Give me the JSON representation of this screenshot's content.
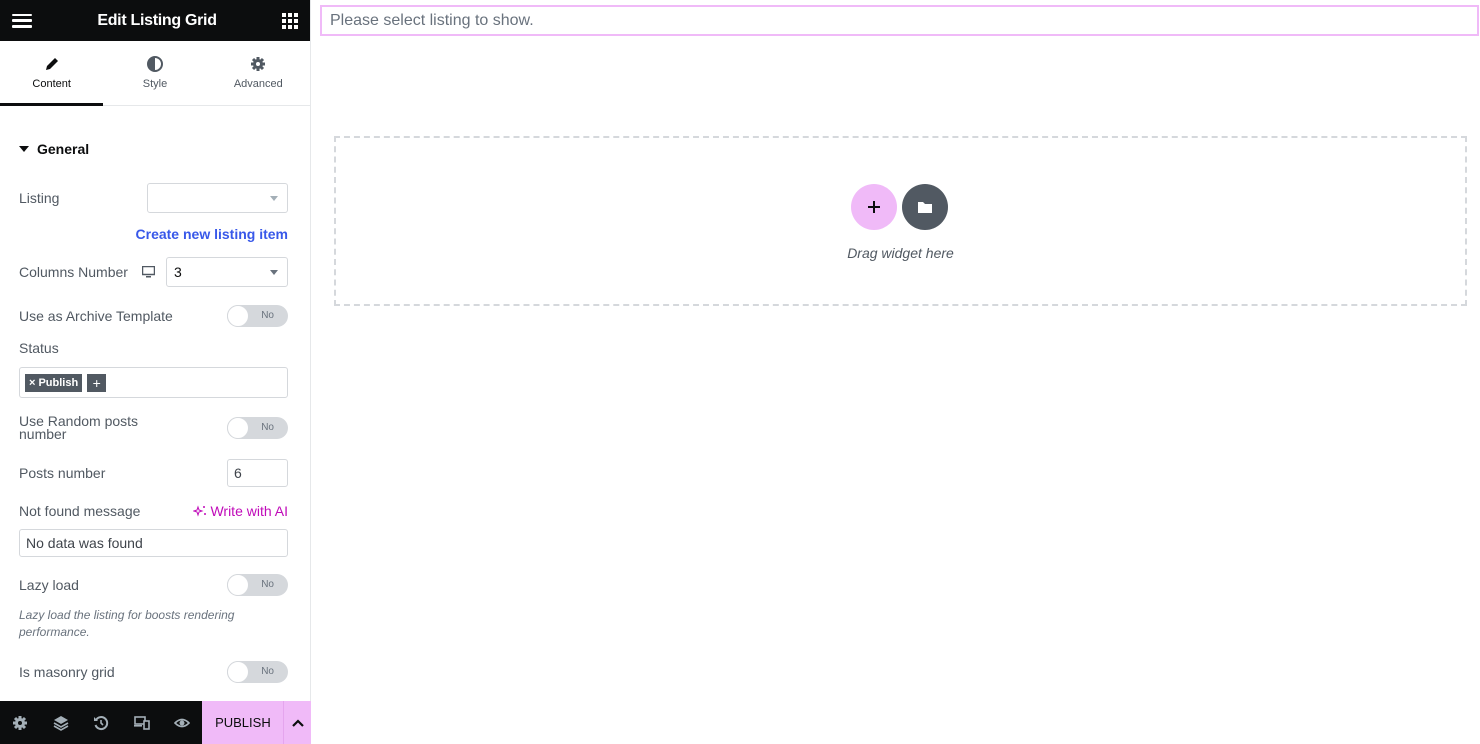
{
  "header": {
    "title": "Edit Listing Grid",
    "menu_icon": "hamburger-icon",
    "apps_icon": "grid-icon"
  },
  "tabs": [
    {
      "label": "Content",
      "icon": "pencil-icon",
      "active": true
    },
    {
      "label": "Style",
      "icon": "half-circle-icon",
      "active": false
    },
    {
      "label": "Advanced",
      "icon": "gear-icon",
      "active": false
    }
  ],
  "section": {
    "title": "General"
  },
  "fields": {
    "listing": {
      "label": "Listing",
      "value": ""
    },
    "create_link": "Create new listing item",
    "columns": {
      "label": "Columns Number",
      "value": "3",
      "device_icon": "desktop-icon"
    },
    "archive": {
      "label": "Use as Archive Template",
      "value": "No"
    },
    "status": {
      "label": "Status",
      "tags": [
        "Publish"
      ],
      "remove_glyph": "×",
      "add_glyph": "+"
    },
    "random": {
      "label": "Use Random posts number",
      "value": "No"
    },
    "posts_number": {
      "label": "Posts number",
      "value": "6"
    },
    "not_found": {
      "label": "Not found message",
      "ai_label": "Write with AI",
      "value": "No data was found"
    },
    "lazy": {
      "label": "Lazy load",
      "value": "No",
      "description": "Lazy load the listing for boosts rendering performance."
    },
    "masonry": {
      "label": "Is masonry grid",
      "value": "No"
    }
  },
  "footer": {
    "icons": [
      "settings-icon",
      "layers-icon",
      "history-icon",
      "responsive-icon",
      "preview-icon"
    ],
    "publish_label": "PUBLISH"
  },
  "preview": {
    "notice": "Please select listing to show.",
    "drop_text": "Drag widget here"
  },
  "colors": {
    "accent": "#f0baf8",
    "dark": "#0c0d0e",
    "link": "#3858e9",
    "ai": "#c00bb9"
  }
}
